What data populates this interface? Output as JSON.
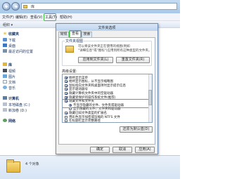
{
  "window": {
    "address": "库",
    "menus": [
      "文件(F)",
      "编辑(E)",
      "查看(V)",
      "工具(T)",
      "帮助(H)"
    ],
    "organize": "组织 ▾"
  },
  "nav": {
    "favorites": {
      "label": "收藏夹",
      "items": [
        "下载",
        "桌面",
        "最近访问的位置"
      ]
    },
    "libraries": {
      "label": "库",
      "items": [
        "视频",
        "图片",
        "文档",
        "音乐"
      ]
    },
    "computer": {
      "label": "计算机",
      "items": [
        "本地磁盘 (C:)",
        "新加卷 (D:)"
      ]
    },
    "network": {
      "label": "网络"
    }
  },
  "details": {
    "count": "4 个对象"
  },
  "dialog": {
    "title": "文件夹选项",
    "tabs": [
      "常规",
      "查看",
      "搜索"
    ],
    "active_tab": "查看",
    "views": {
      "legend": "文件夹视图",
      "desc1": "可以将该文件夹正在使用的视图(例如",
      "desc2": "\"详细信息\"或\"图标\")应用到所有这种类型的文件夹。",
      "apply_btn": "应用到文件夹(L)",
      "reset_btn": "重置文件夹(R)"
    },
    "advanced": {
      "label": "高级设置:",
      "rows": [
        {
          "kind": "cb",
          "on": true,
          "text": "始终显示菜单"
        },
        {
          "kind": "cb",
          "on": true,
          "text": "始终显示图标，从不显示缩略图"
        },
        {
          "kind": "cb",
          "on": true,
          "text": "鼠标指向文件夹和桌面项时显示提示信息"
        },
        {
          "kind": "cb",
          "on": true,
          "text": "显示驱动器号"
        },
        {
          "kind": "cb",
          "on": true,
          "text": "隐藏计算机文件夹中的空驱动器"
        },
        {
          "kind": "cb",
          "on": true,
          "text": "隐藏受保护的操作系统文件(推荐)"
        },
        {
          "kind": "cb",
          "on": true,
          "text": "隐藏文件和文件夹",
          "highlight": true
        },
        {
          "kind": "rb",
          "on": true,
          "text": "不显示隐藏的文件、文件夹或驱动器",
          "indent": true,
          "highlight": true
        },
        {
          "kind": "rb",
          "on": false,
          "text": "显示隐藏的文件、文件夹和驱动器",
          "indent": true
        },
        {
          "kind": "cb",
          "on": true,
          "text": "隐藏已知文件类型的扩展名"
        },
        {
          "kind": "cb",
          "on": false,
          "text": "用彩色显示加密或压缩的 NTFS 文件"
        },
        {
          "kind": "cb",
          "on": false,
          "text": "在标题栏显示完整路径"
        }
      ]
    },
    "restore_btn": "还原为默认值(D)",
    "ok": "确定",
    "cancel": "取消",
    "apply": "应用(A)"
  },
  "colors": {
    "highlight": "#3fbf3f",
    "folder": "#e4b53c",
    "titlebar": "#bcd3ee"
  }
}
